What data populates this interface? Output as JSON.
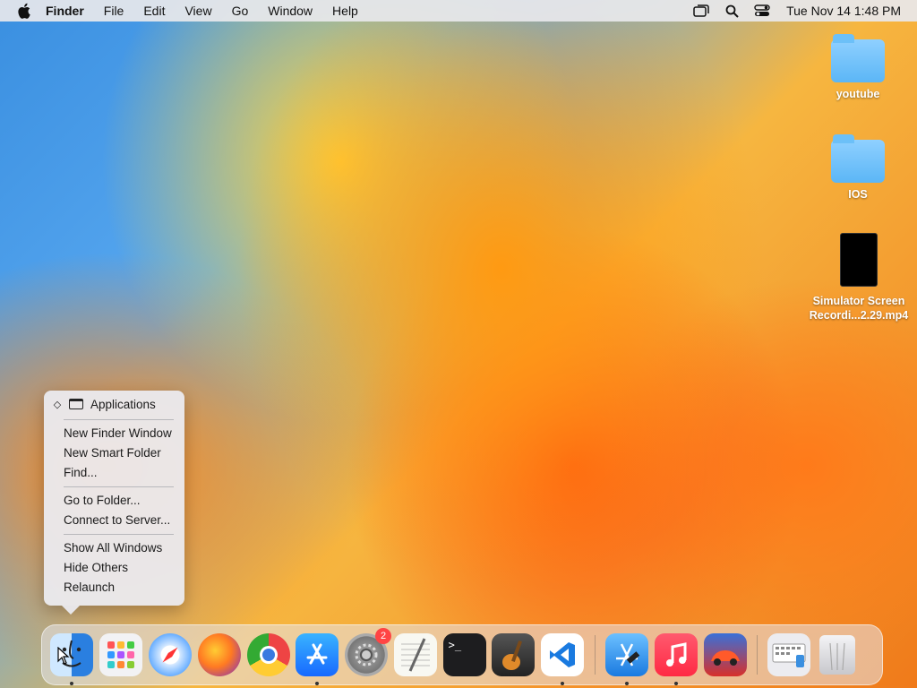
{
  "menubar": {
    "app_name": "Finder",
    "items": [
      "File",
      "Edit",
      "View",
      "Go",
      "Window",
      "Help"
    ],
    "clock": "Tue Nov 14  1:48 PM",
    "tray_icons": [
      "screen-mirroring-icon",
      "spotlight-icon",
      "control-center-icon"
    ]
  },
  "desktop": {
    "items": [
      {
        "label": "youtube",
        "type": "folder"
      },
      {
        "label": "IOS",
        "type": "folder"
      },
      {
        "label": "Simulator Screen Recordi...2.29.mp4",
        "type": "video"
      }
    ]
  },
  "context_menu": {
    "header": "Applications",
    "groups": [
      [
        "New Finder Window",
        "New Smart Folder",
        "Find..."
      ],
      [
        "Go to Folder...",
        "Connect to Server..."
      ],
      [
        "Show All Windows",
        "Hide Others",
        "Relaunch"
      ]
    ]
  },
  "dock": {
    "apps": [
      {
        "name": "Finder",
        "icon": "finder-icon",
        "running": true
      },
      {
        "name": "Launchpad",
        "icon": "launchpad-icon",
        "running": false
      },
      {
        "name": "Safari",
        "icon": "safari-icon",
        "running": false
      },
      {
        "name": "Firefox",
        "icon": "firefox-icon",
        "running": false
      },
      {
        "name": "Chrome",
        "icon": "chrome-icon",
        "running": false
      },
      {
        "name": "App Store",
        "icon": "app-store-icon",
        "running": true
      },
      {
        "name": "System Settings",
        "icon": "system-settings-icon",
        "running": false,
        "badge": "2"
      },
      {
        "name": "TextEdit",
        "icon": "textedit-icon",
        "running": false
      },
      {
        "name": "Terminal",
        "icon": "terminal-icon",
        "running": false,
        "glyph": ">_"
      },
      {
        "name": "GarageBand",
        "icon": "garageband-icon",
        "running": false
      },
      {
        "name": "Visual Studio Code",
        "icon": "vscode-icon",
        "running": true
      },
      {
        "name": "Xcode",
        "icon": "xcode-icon",
        "running": true
      },
      {
        "name": "Music",
        "icon": "music-icon",
        "running": true
      },
      {
        "name": "Game",
        "icon": "game-icon",
        "running": false
      },
      {
        "name": "Finder Preferences",
        "icon": "finder-preferences-icon",
        "running": false
      },
      {
        "name": "Trash",
        "icon": "trash-icon",
        "running": false
      }
    ]
  }
}
